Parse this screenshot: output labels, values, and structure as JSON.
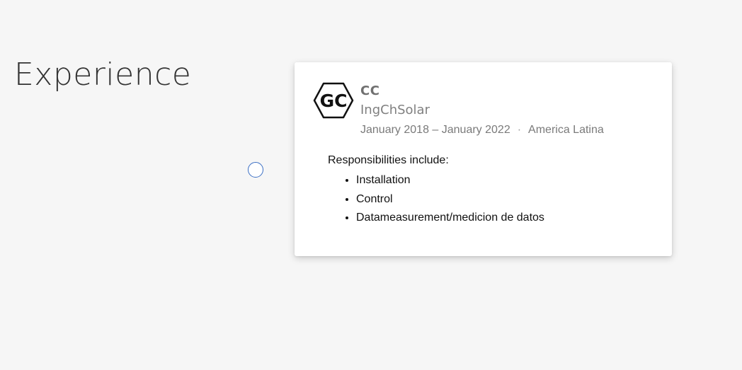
{
  "section": {
    "title": "Experience"
  },
  "experience": {
    "logo_text": "GC",
    "role": "CC",
    "company": "IngChSolar",
    "period": "January 2018 – January 2022",
    "separator": "·",
    "location": "America Latina",
    "responsibilities_title": "Responsibilities include:",
    "responsibilities": [
      "Installation",
      "Control",
      "Datameasurement/medicion de datos"
    ]
  },
  "colors": {
    "background": "#f6f6f6",
    "timeline_dot_border": "#3b6fc4",
    "card": "#ffffff",
    "title_text": "#333333",
    "muted_text": "#7a7a7a"
  }
}
